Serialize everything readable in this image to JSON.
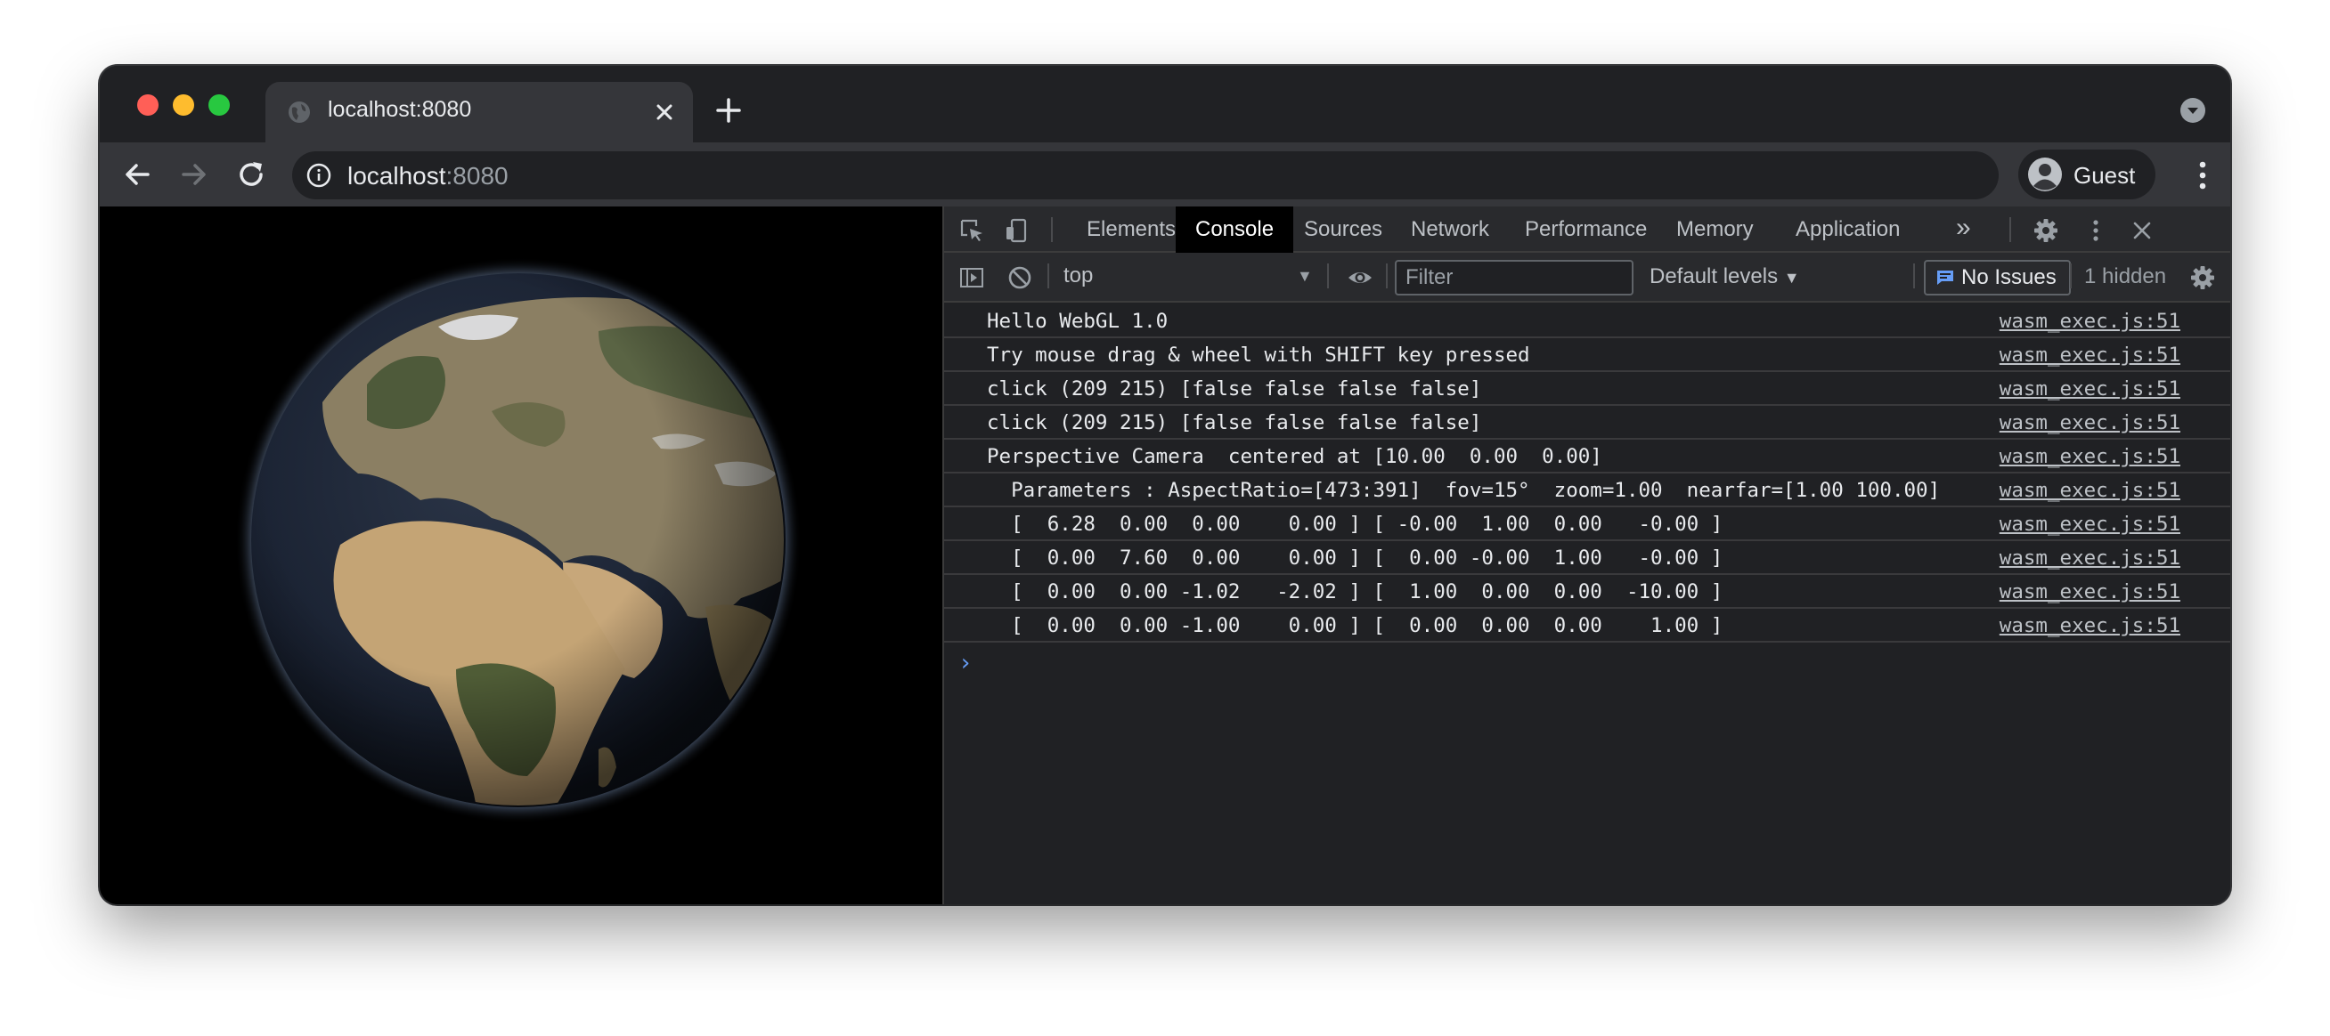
{
  "browser": {
    "tab_title": "localhost:8080",
    "url_host": "localhost",
    "url_port": ":8080",
    "profile_name": "Guest"
  },
  "devtools": {
    "tabs": [
      {
        "label": "Elements"
      },
      {
        "label": "Console",
        "active": true
      },
      {
        "label": "Sources"
      },
      {
        "label": "Network"
      },
      {
        "label": "Performance"
      },
      {
        "label": "Memory"
      },
      {
        "label": "Application"
      }
    ],
    "more_tabs_glyph": "»",
    "console_bar": {
      "context": "top",
      "filter_placeholder": "Filter",
      "filter_value": "",
      "levels": "Default levels",
      "issues": "No Issues",
      "hidden": "1 hidden"
    },
    "logs": [
      {
        "msg": "Hello WebGL 1.0",
        "src": "wasm_exec.js:51"
      },
      {
        "msg": "Try mouse drag & wheel with SHIFT key pressed",
        "src": "wasm_exec.js:51"
      },
      {
        "msg": "click (209 215) [false false false false]",
        "src": "wasm_exec.js:51"
      },
      {
        "msg": "click (209 215) [false false false false]",
        "src": "wasm_exec.js:51"
      },
      {
        "msg": "Perspective Camera  centered at [10.00  0.00  0.00]",
        "src": "wasm_exec.js:51"
      },
      {
        "msg": "  Parameters : AspectRatio=[473:391]  fov=15°  zoom=1.00  nearfar=[1.00 100.00]",
        "src": "wasm_exec.js:51"
      },
      {
        "msg": "  [  6.28  0.00  0.00    0.00 ] [ -0.00  1.00  0.00   -0.00 ]",
        "src": "wasm_exec.js:51"
      },
      {
        "msg": "  [  0.00  7.60  0.00    0.00 ] [  0.00 -0.00  1.00   -0.00 ]",
        "src": "wasm_exec.js:51"
      },
      {
        "msg": "  [  0.00  0.00 -1.02   -2.02 ] [  1.00  0.00  0.00  -10.00 ]",
        "src": "wasm_exec.js:51"
      },
      {
        "msg": "  [  0.00  0.00 -1.00    0.00 ] [  0.00  0.00  0.00    1.00 ]",
        "src": "wasm_exec.js:51"
      }
    ],
    "prompt_glyph": "›"
  },
  "colors": {
    "accent": "#669df6",
    "traffic_red": "#ff5f57",
    "traffic_yellow": "#febc2e",
    "traffic_green": "#28c840"
  }
}
